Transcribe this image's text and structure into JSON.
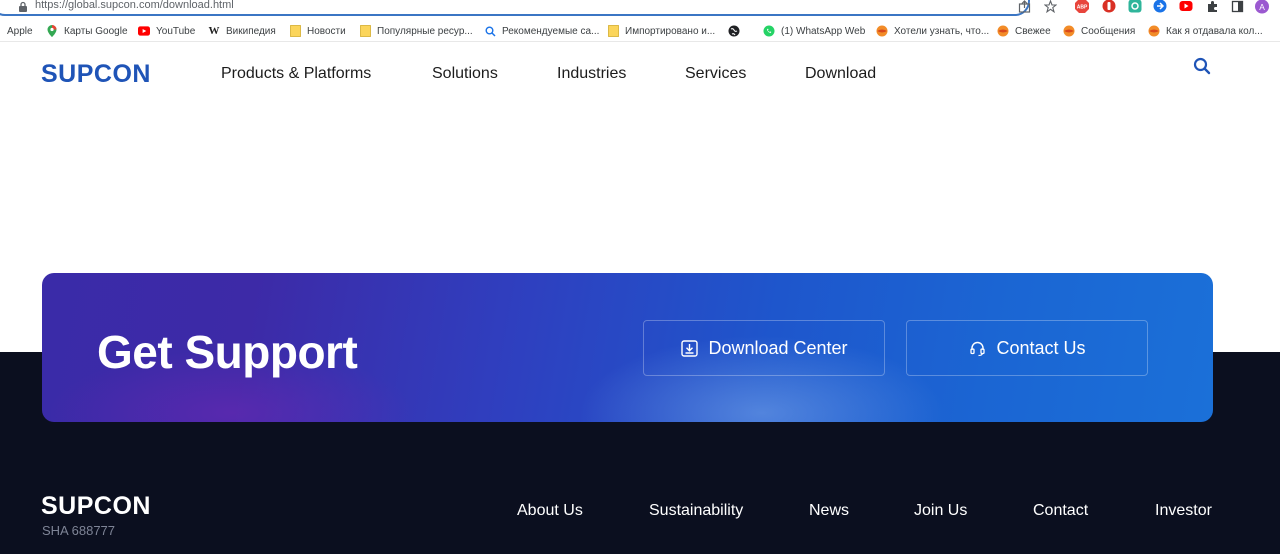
{
  "browser": {
    "url": "https://global.supcon.com/download.html",
    "profile_initial": "A",
    "extensions": [
      "abp-icon",
      "adblock-red-icon",
      "grammarly-icon",
      "extension-blue-icon",
      "youtube-ext-icon",
      "puzzle-icon"
    ]
  },
  "bookmarks": [
    {
      "label": "Apple",
      "icon": "none"
    },
    {
      "label": "Карты Google",
      "icon": "maps-pin-icon"
    },
    {
      "label": "YouTube",
      "icon": "youtube-icon"
    },
    {
      "label": "Википедия",
      "icon": "wikipedia-icon"
    },
    {
      "label": "Новости",
      "icon": "folder-icon"
    },
    {
      "label": "Популярные ресур...",
      "icon": "folder-icon"
    },
    {
      "label": "Рекомендуемые са...",
      "icon": "search-icon"
    },
    {
      "label": "Импортировано и...",
      "icon": "folder-icon"
    },
    {
      "label": "",
      "icon": "globe-icon"
    },
    {
      "label": "(1) WhatsApp Web",
      "icon": "whatsapp-icon"
    },
    {
      "label": "Хотели узнать, что...",
      "icon": "orange-ball-icon"
    },
    {
      "label": "Свежее",
      "icon": "orange-ball-icon"
    },
    {
      "label": "Сообщения",
      "icon": "orange-ball-icon"
    },
    {
      "label": "Как я отдавала кол...",
      "icon": "orange-ball-icon"
    }
  ],
  "header": {
    "logo": "SUPCON",
    "nav": [
      "Products & Platforms",
      "Solutions",
      "Industries",
      "Services",
      "Download"
    ]
  },
  "banner": {
    "title": "Get Support",
    "download_label": "Download Center",
    "contact_label": "Contact Us"
  },
  "footer": {
    "logo": "SUPCON",
    "stock": "SHA 688777",
    "links": [
      "About Us",
      "Sustainability",
      "News",
      "Join Us",
      "Contact",
      "Investor"
    ]
  },
  "colors": {
    "brand_blue": "#1f54b7",
    "footer_bg": "#0b0f1f",
    "address_focus": "#3b76c4"
  }
}
